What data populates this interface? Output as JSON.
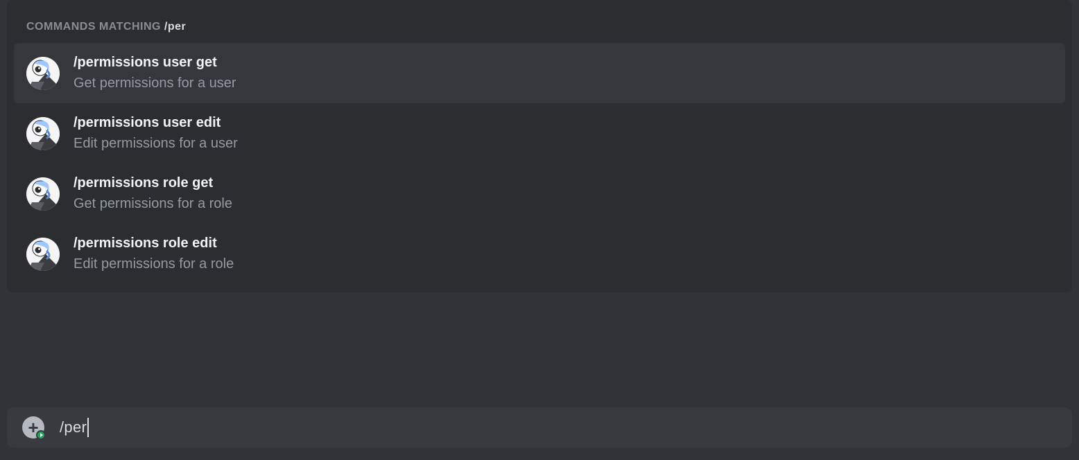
{
  "header": {
    "label": "Commands matching",
    "query": "/per"
  },
  "commands": [
    {
      "name": "/permissions user get",
      "description": "Get permissions for a user",
      "icon": "bot-avatar",
      "selected": true
    },
    {
      "name": "/permissions user edit",
      "description": "Edit permissions for a user",
      "icon": "bot-avatar",
      "selected": false
    },
    {
      "name": "/permissions role get",
      "description": "Get permissions for a role",
      "icon": "bot-avatar",
      "selected": false
    },
    {
      "name": "/permissions role edit",
      "description": "Edit permissions for a role",
      "icon": "bot-avatar",
      "selected": false
    }
  ],
  "input": {
    "value": "/per",
    "attach_icon": "plus-circle-icon",
    "attach_badge_icon": "play-badge-icon"
  },
  "colors": {
    "panel_bg": "#2b2d31",
    "item_hover_bg": "#35373c",
    "input_bg": "#383a40",
    "text_primary": "#f2f3f5",
    "text_secondary": "#949ba4",
    "badge_green": "#23a559"
  }
}
